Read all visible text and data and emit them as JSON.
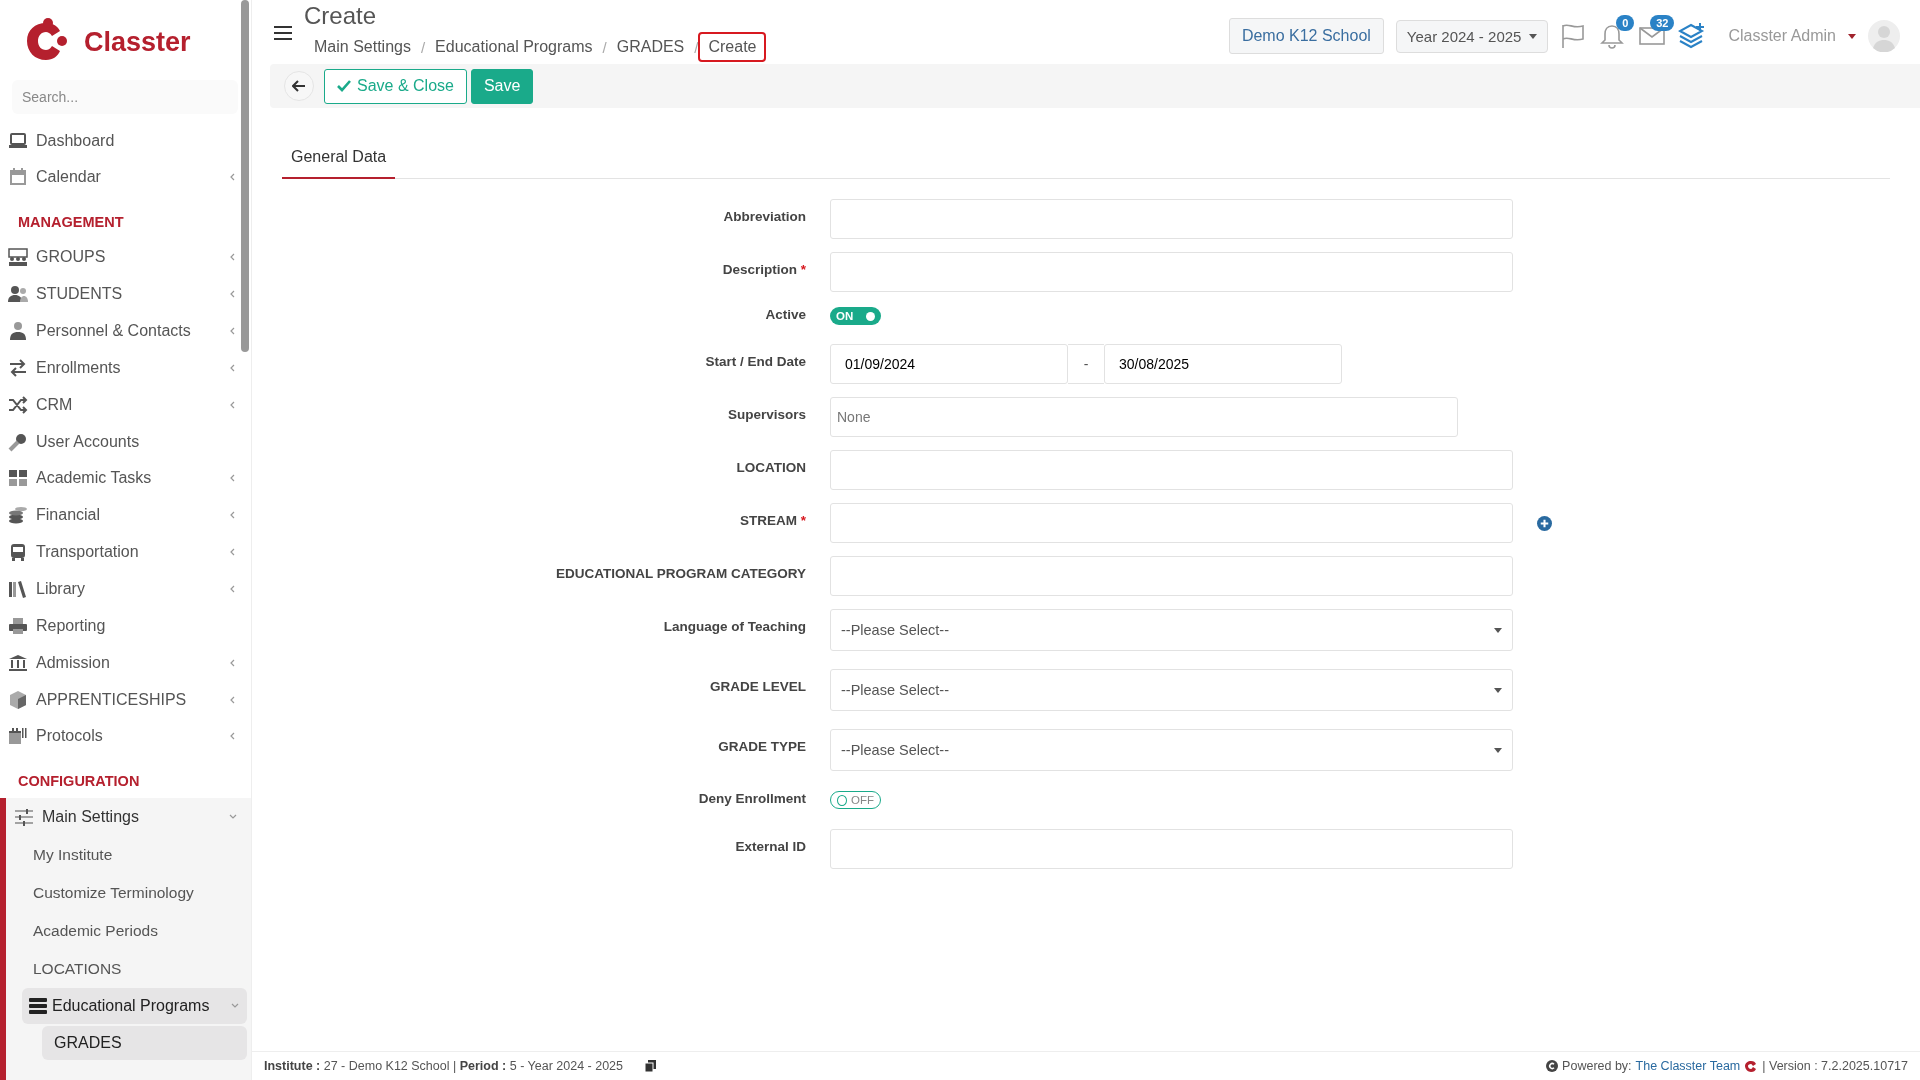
{
  "sidebar": {
    "logo_text": "Classter",
    "search": {
      "placeholder": "Search..."
    },
    "groups": [
      {
        "items": [
          {
            "label": "Dashboard",
            "kind": "link",
            "selected": false
          },
          {
            "label": "Calendar",
            "kind": "group",
            "expanded": false,
            "selected": false
          }
        ]
      },
      {
        "heading": "MANAGEMENT",
        "items": [
          {
            "label": "GROUPS",
            "kind": "group",
            "expanded": false,
            "selected": false
          },
          {
            "label": "STUDENTS",
            "kind": "group",
            "expanded": false,
            "selected": false
          },
          {
            "label": "Personnel & Contacts",
            "kind": "group",
            "expanded": false,
            "selected": false
          },
          {
            "label": "Enrollments",
            "kind": "group",
            "expanded": false,
            "selected": false
          },
          {
            "label": "CRM",
            "kind": "group",
            "expanded": false,
            "selected": false
          },
          {
            "label": "User Accounts",
            "kind": "link",
            "selected": false
          },
          {
            "label": "Academic Tasks",
            "kind": "group",
            "expanded": false,
            "selected": false
          },
          {
            "label": "Financial",
            "kind": "group",
            "expanded": false,
            "selected": false
          },
          {
            "label": "Transportation",
            "kind": "group",
            "expanded": false,
            "selected": false
          },
          {
            "label": "Library",
            "kind": "group",
            "expanded": false,
            "selected": false
          },
          {
            "label": "Reporting",
            "kind": "link",
            "selected": false
          },
          {
            "label": "Admission",
            "kind": "group",
            "expanded": false,
            "selected": false
          },
          {
            "label": "APPRENTICESHIPS",
            "kind": "group",
            "expanded": false,
            "selected": false
          },
          {
            "label": "Protocols",
            "kind": "group",
            "expanded": false,
            "selected": false
          }
        ]
      },
      {
        "heading": "CONFIGURATION",
        "items": [
          {
            "label": "Main Settings",
            "kind": "group",
            "expanded": true,
            "selected": false,
            "children": [
              {
                "label": "My Institute",
                "kind": "link",
                "selected": false
              },
              {
                "label": "Customize Terminology",
                "kind": "link",
                "selected": false
              },
              {
                "label": "Academic Periods",
                "kind": "link",
                "selected": false
              },
              {
                "label": "LOCATIONS",
                "kind": "link",
                "selected": false
              },
              {
                "label": "Educational Programs",
                "kind": "group",
                "expanded": true,
                "selected": false,
                "children": [
                  {
                    "label": "GRADES",
                    "kind": "link",
                    "selected": true
                  }
                ]
              }
            ]
          }
        ]
      }
    ]
  },
  "header": {
    "title": "Create",
    "breadcrumbs": [
      {
        "label": "Main Settings",
        "selected": false
      },
      {
        "label": "Educational Programs",
        "selected": false
      },
      {
        "label": "GRADES",
        "selected": false
      },
      {
        "label": "Create",
        "selected": true
      }
    ],
    "separator": "/",
    "school": "Demo K12 School",
    "year": "Year 2024 - 2025",
    "notifications": "0",
    "messages": "32",
    "user": "Classter Admin"
  },
  "toolbar": {
    "buttons": [
      {
        "label": "Save & Close",
        "kind": "outline"
      },
      {
        "label": "Save",
        "kind": "primary"
      }
    ]
  },
  "tabs": [
    {
      "label": "General Data",
      "selected": true
    }
  ],
  "form": [
    {
      "label": "Abbreviation",
      "kind": "text"
    },
    {
      "label": "Description",
      "kind": "text",
      "mark": "*"
    },
    {
      "label": "Active",
      "kind": "toggle",
      "on": true,
      "text": "ON"
    },
    {
      "label": "Start / End Date",
      "kind": "daterange",
      "start": "01/09/2024",
      "separator": "-",
      "end": "30/08/2025"
    },
    {
      "label": "Supervisors",
      "kind": "multiselect",
      "placeholder": "None"
    },
    {
      "label": "LOCATION",
      "kind": "text"
    },
    {
      "label": "STREAM",
      "kind": "text",
      "mark": "*",
      "add": true
    },
    {
      "label": "EDUCATIONAL PROGRAM CATEGORY",
      "kind": "text"
    },
    {
      "label": "Language of Teaching",
      "kind": "select",
      "value": "--Please Select--"
    },
    {
      "label": "GRADE LEVEL",
      "kind": "select",
      "value": "--Please Select--"
    },
    {
      "label": "GRADE TYPE",
      "kind": "select",
      "value": "--Please Select--"
    },
    {
      "label": "Deny Enrollment",
      "kind": "toggle",
      "on": false,
      "text": "OFF"
    },
    {
      "label": "External ID",
      "kind": "text"
    }
  ],
  "footer": {
    "info": "**Institute :** 27 - Demo K12 School | **Period :** 5 - Year 2024 - 2025",
    "powered_by": "Powered by:",
    "team": "The Classter Team",
    "version": "| Version : 7.2.2025.10717"
  }
}
